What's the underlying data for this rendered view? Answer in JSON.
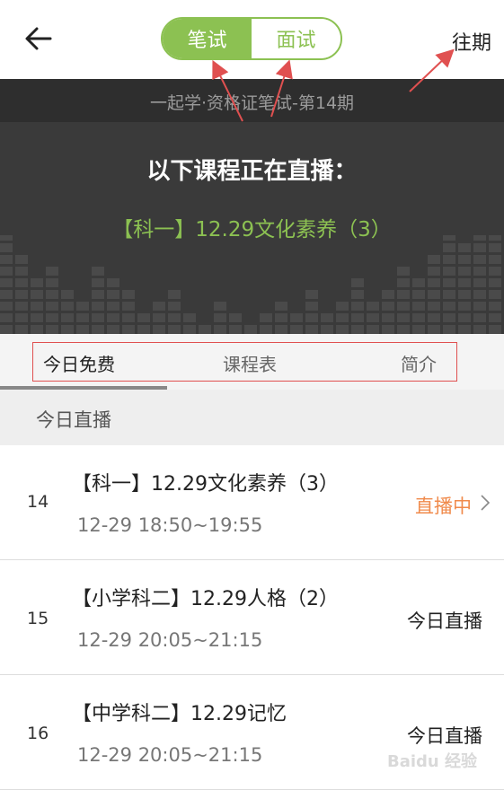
{
  "header": {
    "back_icon": "arrow-left-icon",
    "segment": {
      "written": "笔试",
      "interview": "面试",
      "selected": "written"
    },
    "history_label": "往期"
  },
  "banner": {
    "subtitle": "一起学·资格证笔试-第14期",
    "live_heading": "以下课程正在直播：",
    "live_course": "【科一】12.29文化素养（3）"
  },
  "tabs": [
    {
      "label": "今日免费",
      "active": true
    },
    {
      "label": "课程表",
      "active": false
    },
    {
      "label": "简介",
      "active": false
    }
  ],
  "section": {
    "title": "今日直播"
  },
  "courses": [
    {
      "num": "14",
      "title": "【科一】12.29文化素养（3）",
      "time": "12-29 18:50~19:55",
      "status": "直播中",
      "status_type": "live"
    },
    {
      "num": "15",
      "title": "【小学科二】12.29人格（2）",
      "time": "12-29 20:05~21:15",
      "status": "今日直播",
      "status_type": "today"
    },
    {
      "num": "16",
      "title": "【中学科二】12.29记忆",
      "time": "12-29 20:05~21:15",
      "status": "今日直播",
      "status_type": "today"
    }
  ],
  "colors": {
    "accent": "#8cc152",
    "live": "#f08a4b",
    "annotation": "#e05050"
  }
}
